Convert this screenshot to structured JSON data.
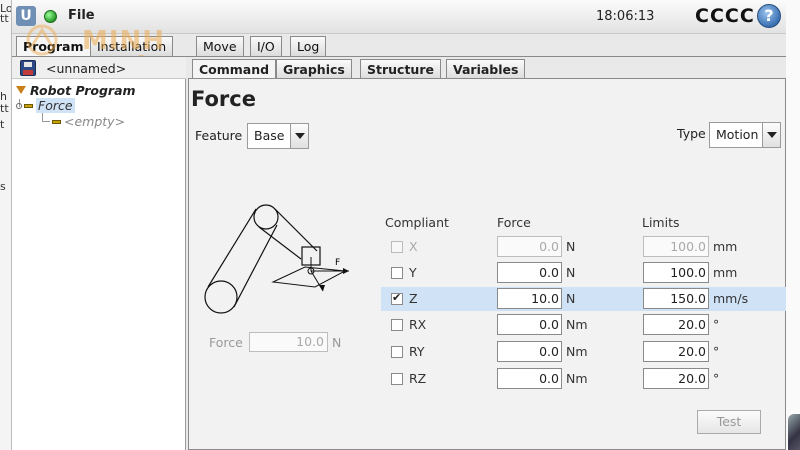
{
  "left_edge_fragments": [
    "Lo",
    "tt",
    "h",
    "tt",
    "t",
    "s"
  ],
  "header": {
    "file_menu": "File",
    "clock": "18:06:13",
    "robot_name": "CCCC",
    "help_icon": "help-icon",
    "logo_icon": "ur-logo-icon",
    "status_icon": "robot-status-dot-icon",
    "status_color": "#2a9a2a"
  },
  "watermark": "MINH TRIỆU",
  "top_tabs": [
    {
      "label": "Program",
      "active": true
    },
    {
      "label": "Installation",
      "active": false
    },
    {
      "label": "Move",
      "active": false
    },
    {
      "label": "I/O",
      "active": false
    },
    {
      "label": "Log",
      "active": false
    }
  ],
  "program_panel": {
    "program_name": "<unnamed>",
    "tree": {
      "root": "Robot Program",
      "force_node": "Force",
      "empty_node": "<empty>"
    }
  },
  "sub_tabs": [
    {
      "label": "Command",
      "active": true
    },
    {
      "label": "Graphics",
      "active": false
    },
    {
      "label": "Structure",
      "active": false
    },
    {
      "label": "Variables",
      "active": false
    }
  ],
  "command": {
    "title": "Force",
    "feature_label": "Feature",
    "feature_value": "Base",
    "type_label": "Type",
    "type_value": "Motion",
    "headers": {
      "compliant": "Compliant",
      "force": "Force",
      "limits": "Limits"
    },
    "rows": [
      {
        "axis": "X",
        "checked": false,
        "disabled": true,
        "force": "0.0",
        "force_unit": "N",
        "limit": "100.0",
        "limit_unit": "mm"
      },
      {
        "axis": "Y",
        "checked": false,
        "disabled": false,
        "force": "0.0",
        "force_unit": "N",
        "limit": "100.0",
        "limit_unit": "mm"
      },
      {
        "axis": "Z",
        "checked": true,
        "disabled": false,
        "force": "10.0",
        "force_unit": "N",
        "limit": "150.0",
        "limit_unit": "mm/s"
      },
      {
        "axis": "RX",
        "checked": false,
        "disabled": false,
        "force": "0.0",
        "force_unit": "Nm",
        "limit": "20.0",
        "limit_unit": "°"
      },
      {
        "axis": "RY",
        "checked": false,
        "disabled": false,
        "force": "0.0",
        "force_unit": "Nm",
        "limit": "20.0",
        "limit_unit": "°"
      },
      {
        "axis": "RZ",
        "checked": false,
        "disabled": false,
        "force": "0.0",
        "force_unit": "Nm",
        "limit": "20.0",
        "limit_unit": "°"
      }
    ],
    "selected_row": "Z",
    "diagram_label": "F",
    "force_total_label": "Force",
    "force_total_value": "10.0",
    "force_total_unit": "N",
    "test_button": "Test"
  }
}
